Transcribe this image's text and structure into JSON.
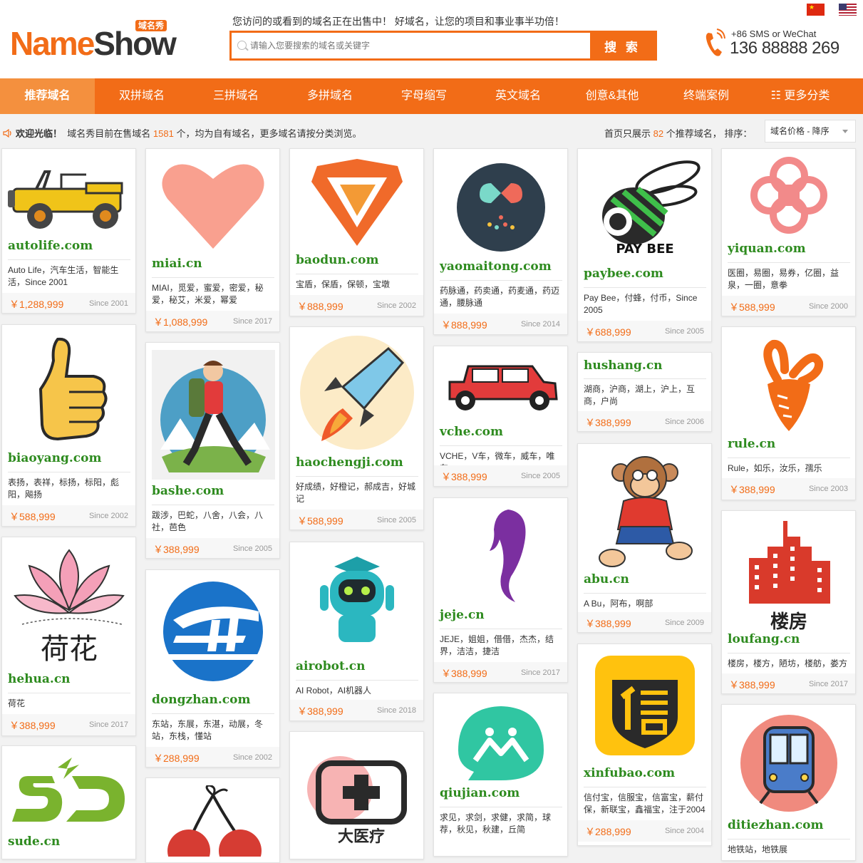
{
  "header": {
    "logo_part1": "Name",
    "logo_part2": "Show",
    "logo_tag": "域名秀",
    "slogan": "您访问的或看到的域名正在出售中！ 好域名，让您的项目和事业事半功倍！",
    "search_placeholder": "请输入您要搜索的域名或关键字",
    "search_button": "搜 索",
    "contact_line1": "+86    SMS or WeChat",
    "contact_phone": "136 88888 269"
  },
  "nav": [
    "推荐域名",
    "双拼域名",
    "三拼域名",
    "多拼域名",
    "字母缩写",
    "英文域名",
    "创意&其他",
    "终端案例",
    "☷ 更多分类"
  ],
  "infobar": {
    "welcome": "欢迎光临！",
    "text_a": "域名秀目前在售域名",
    "count": "1581",
    "text_b": "个，均为自有域名，更多域名请按分类浏览。",
    "right_a": "首页只展示",
    "right_count": "82",
    "right_b": "个推荐域名，  排序：",
    "sort_value": "域名价格 - 降序"
  },
  "cards": [
    {
      "name": "autolife.com",
      "desc": "Auto Life，汽车生活，智能生活，Since 2001",
      "price": "￥1,288,999",
      "since": "Since 2001",
      "icon": "jeep-logo"
    },
    {
      "name": "biaoyang.com",
      "desc": "表扬，表祥，标扬，标阳，彪阳，飚扬",
      "price": "￥588,999",
      "since": "Since 2002",
      "icon": "thumbs-up-logo"
    },
    {
      "name": "hehua.cn",
      "desc": "荷花",
      "price": "￥388,999",
      "since": "Since 2017",
      "icon": "lotus-logo",
      "logo_text": "荷花"
    },
    {
      "name": "sude.cn",
      "desc": "",
      "price": "",
      "since": "",
      "icon": "sd-logo"
    },
    {
      "name": "miai.cn",
      "desc": "MIAI，觅爱，蜜爱，密爱，秘爱，秘艾，米爱，幂爱",
      "price": "￥1,088,999",
      "since": "Since 2017",
      "icon": "heart-logo"
    },
    {
      "name": "bashe.com",
      "desc": "跋涉，巴蛇，八舍，八会，八社，芭色",
      "price": "￥388,999",
      "since": "Since 2005",
      "icon": "hiker-logo"
    },
    {
      "name": "dongzhan.com",
      "desc": "东站，东展，东湛，动展，冬站，东栈，懂站",
      "price": "￥288,999",
      "since": "Since 2002",
      "icon": "dz-train-logo"
    },
    {
      "name": "",
      "desc": "",
      "price": "",
      "since": "",
      "icon": "cherry-logo"
    },
    {
      "name": "baodun.com",
      "desc": "宝盾，保盾，保顿，宝墩",
      "price": "￥888,999",
      "since": "Since 2002",
      "icon": "shield-logo"
    },
    {
      "name": "haochengji.com",
      "desc": "好成绩，好橙记，郝成吉，好城记",
      "price": "￥588,999",
      "since": "Since 2005",
      "icon": "rocket-logo"
    },
    {
      "name": "airobot.cn",
      "desc": "AI Robot，AI机器人",
      "price": "￥388,999",
      "since": "Since 2018",
      "icon": "robot-logo"
    },
    {
      "name": "",
      "desc": "",
      "price": "",
      "since": "",
      "icon": "medical-logo",
      "logo_text": "大医疗"
    },
    {
      "name": "yaomaitong.com",
      "desc": "药脉通，药卖通，药麦通，药迈通，腰脉通",
      "price": "￥888,999",
      "since": "Since 2014",
      "icon": "pill-logo"
    },
    {
      "name": "vche.com",
      "desc": "VCHE，V车，微车，威车，唯车",
      "price": "￥388,999",
      "since": "Since 2005",
      "icon": "red-car-logo"
    },
    {
      "name": "jeje.cn",
      "desc": "JEJE，姐姐，借借，杰杰，结界，洁洁，捷洁",
      "price": "￥388,999",
      "since": "Since 2017",
      "icon": "woman-silhouette-logo"
    },
    {
      "name": "qiujian.com",
      "desc": "求见，求剑，求健，求简，球荐，秋见，秋建，丘简",
      "price": "",
      "since": "",
      "icon": "green-mountain-logo"
    },
    {
      "name": "paybee.com",
      "desc": "Pay Bee，付蜂，付币，Since 2005",
      "price": "￥688,999",
      "since": "Since 2005",
      "icon": "bee-logo",
      "logo_text": "PAY BEE"
    },
    {
      "name": "hushang.cn",
      "desc": "湖商，沪商，湖上，沪上，互商，户尚",
      "price": "￥388,999",
      "since": "Since 2006",
      "icon": ""
    },
    {
      "name": "abu.cn",
      "desc": "A Bu，阿布，啊部",
      "price": "￥388,999",
      "since": "Since 2009",
      "icon": "monkey-logo"
    },
    {
      "name": "xinfubao.com",
      "desc": "信付宝，信服宝，信富宝，薪付保，新联宝，鑫福宝，注于2004",
      "price": "￥288,999",
      "since": "Since 2004",
      "icon": "xin-badge-logo"
    },
    {
      "name": "yiquan.com",
      "desc": "医圈，易圈，易券，亿圈，益泉，一圈，意拳",
      "price": "￥588,999",
      "since": "Since 2000",
      "icon": "medical-cross-logo"
    },
    {
      "name": "rule.cn",
      "desc": "Rule，如乐，汝乐，孺乐",
      "price": "￥388,999",
      "since": "Since 2003",
      "icon": "rabbit-carrot-logo"
    },
    {
      "name": "loufang.cn",
      "desc": "楼房，楼方，陋坊，楼舫，娄方",
      "price": "￥388,999",
      "since": "Since 2017",
      "icon": "building-logo",
      "logo_text": "楼房"
    },
    {
      "name": "ditiezhan.com",
      "desc": "地铁站，地铁展",
      "price": "",
      "since": "",
      "icon": "subway-logo"
    }
  ]
}
